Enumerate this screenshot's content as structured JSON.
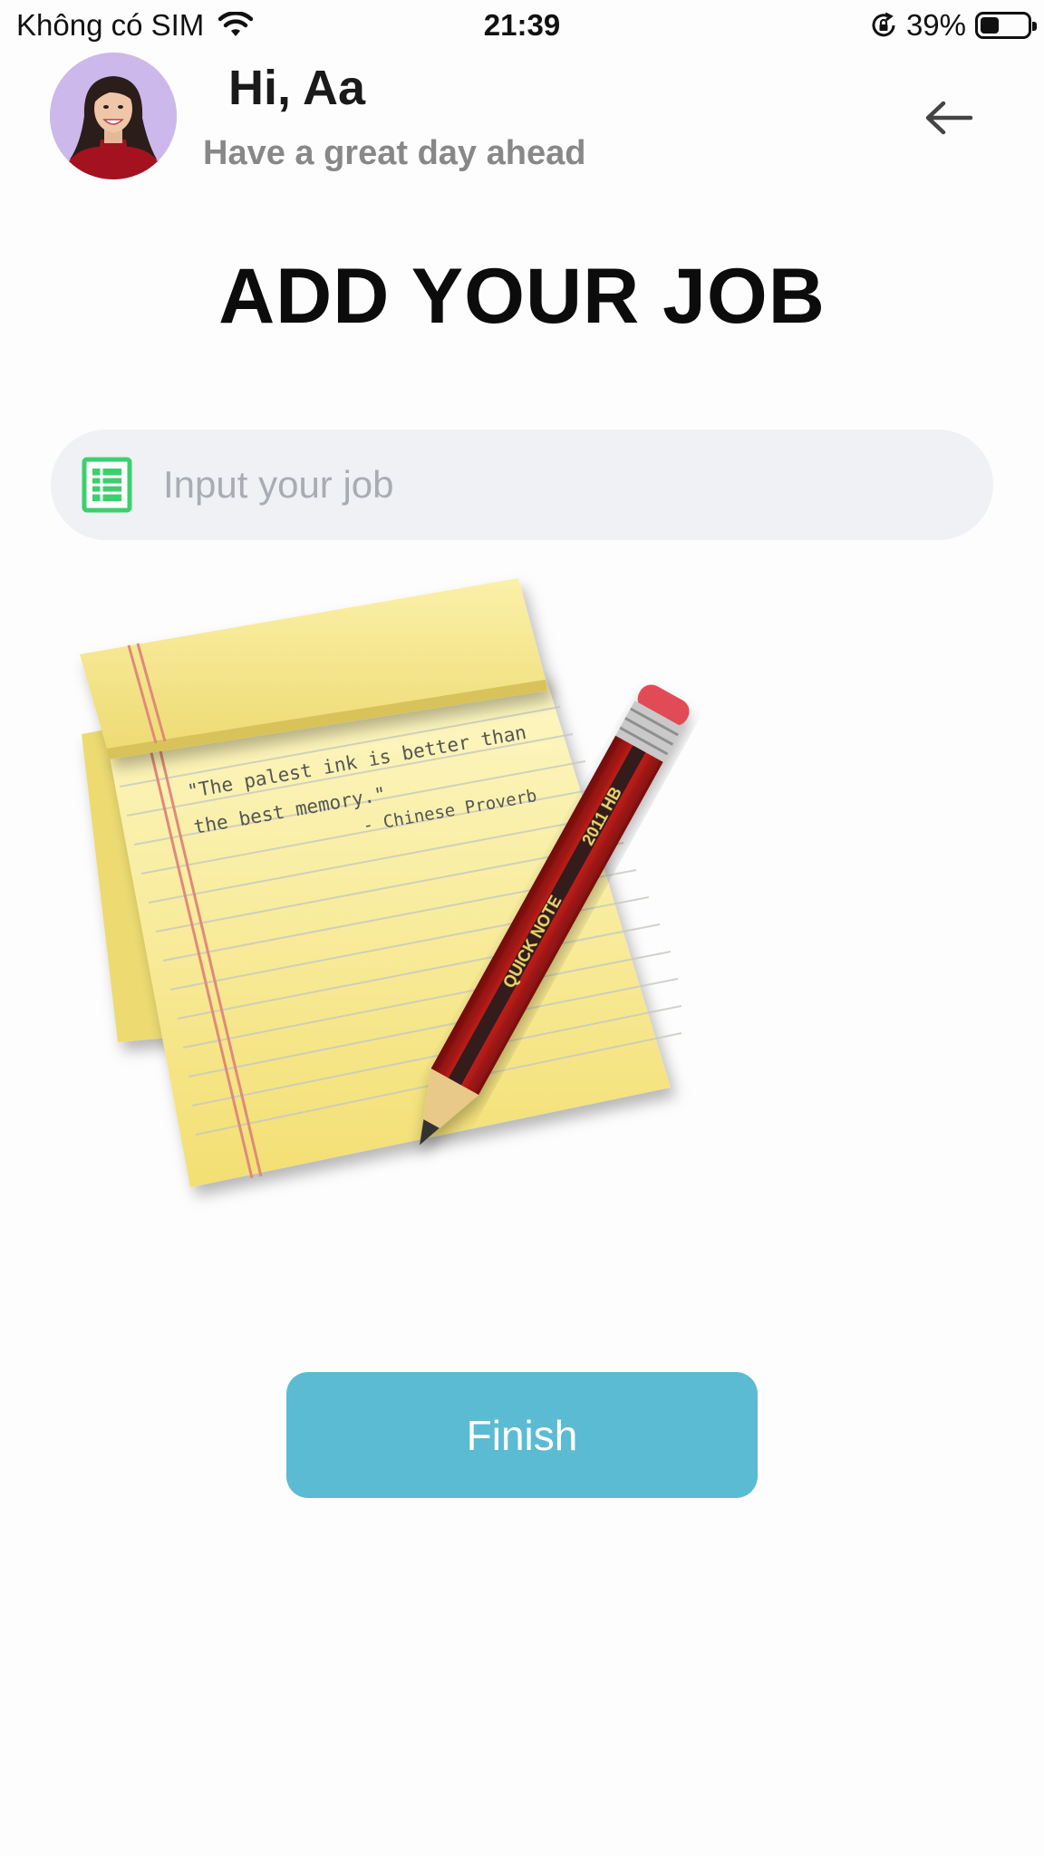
{
  "status_bar": {
    "carrier": "Không có SIM",
    "time": "21:39",
    "battery": "39%",
    "battery_level": 0.39,
    "icons": [
      "wifi-icon",
      "orientation-lock-icon",
      "battery-icon"
    ]
  },
  "header": {
    "greeting": "Hi, Aa",
    "subtitle": "Have a great day ahead",
    "avatar": "avatar",
    "back_icon": "arrow-left-icon"
  },
  "main": {
    "title": "ADD YOUR JOB",
    "job_input": {
      "placeholder": "Input your job",
      "value": "",
      "icon": "spreadsheet-icon"
    },
    "illustration": {
      "icon": "notepad-pencil-icon",
      "quote_line1": "\"The palest ink is better than",
      "quote_line2": "the best memory.\"",
      "quote_author": "- Chinese Proverb",
      "pencil_text_1": "QUICK NOTE",
      "pencil_text_2": "2011 HB"
    },
    "finish_label": "Finish"
  },
  "colors": {
    "accent": "#5bbbd3",
    "input_bg": "#eff1f4",
    "icon_green": "#3ccf6e",
    "subtitle_gray": "#888888"
  }
}
